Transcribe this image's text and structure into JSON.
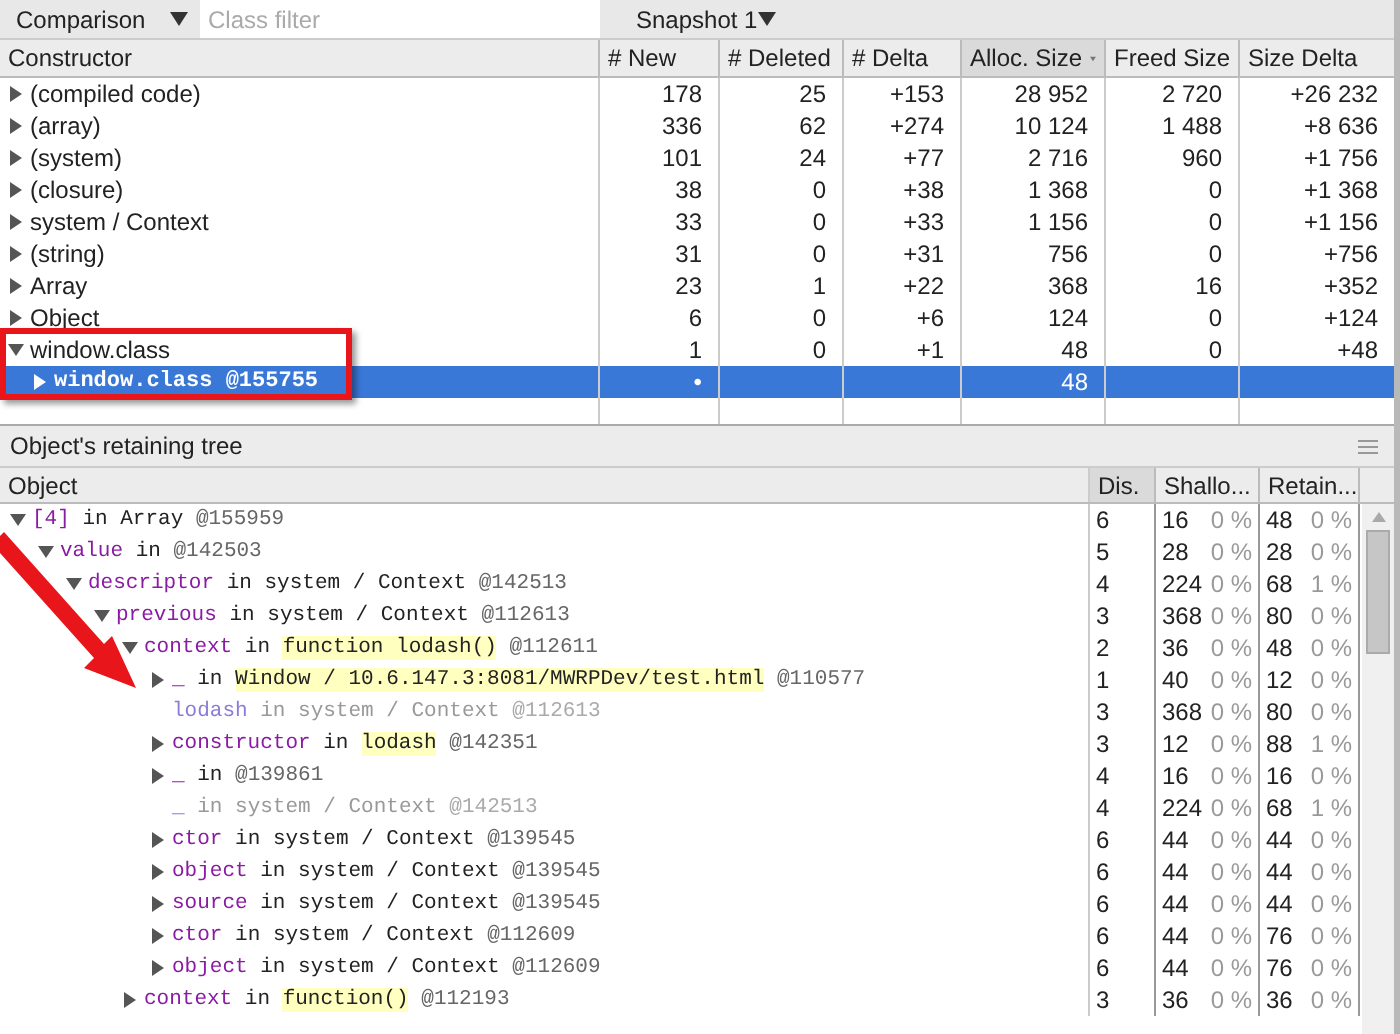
{
  "toolbar": {
    "view_select": "Comparison",
    "class_filter": {
      "placeholder": "Class filter"
    },
    "snapshot_select": "Snapshot 1"
  },
  "summary_table": {
    "columns": [
      {
        "label": "Constructor",
        "sorted": false
      },
      {
        "label": "# New",
        "sorted": false
      },
      {
        "label": "# Deleted",
        "sorted": false
      },
      {
        "label": "# Delta",
        "sorted": false
      },
      {
        "label": "Alloc. Size",
        "sorted": true
      },
      {
        "label": "Freed Size",
        "sorted": false
      },
      {
        "label": "Size Delta",
        "sorted": false
      }
    ],
    "rows": [
      {
        "name": "(compiled code)",
        "new": "178",
        "deleted": "25",
        "delta": "+153",
        "alloc": "28 952",
        "freed": "2 720",
        "size_delta": "+26 232",
        "expanded": false,
        "selected": false
      },
      {
        "name": "(array)",
        "new": "336",
        "deleted": "62",
        "delta": "+274",
        "alloc": "10 124",
        "freed": "1 488",
        "size_delta": "+8 636",
        "expanded": false,
        "selected": false
      },
      {
        "name": "(system)",
        "new": "101",
        "deleted": "24",
        "delta": "+77",
        "alloc": "2 716",
        "freed": "960",
        "size_delta": "+1 756",
        "expanded": false,
        "selected": false
      },
      {
        "name": "(closure)",
        "new": "38",
        "deleted": "0",
        "delta": "+38",
        "alloc": "1 368",
        "freed": "0",
        "size_delta": "+1 368",
        "expanded": false,
        "selected": false
      },
      {
        "name": "system / Context",
        "new": "33",
        "deleted": "0",
        "delta": "+33",
        "alloc": "1 156",
        "freed": "0",
        "size_delta": "+1 156",
        "expanded": false,
        "selected": false
      },
      {
        "name": "(string)",
        "new": "31",
        "deleted": "0",
        "delta": "+31",
        "alloc": "756",
        "freed": "0",
        "size_delta": "+756",
        "expanded": false,
        "selected": false
      },
      {
        "name": "Array",
        "new": "23",
        "deleted": "1",
        "delta": "+22",
        "alloc": "368",
        "freed": "16",
        "size_delta": "+352",
        "expanded": false,
        "selected": false
      },
      {
        "name": "Object",
        "new": "6",
        "deleted": "0",
        "delta": "+6",
        "alloc": "124",
        "freed": "0",
        "size_delta": "+124",
        "expanded": false,
        "selected": false
      },
      {
        "name": "window.class",
        "new": "1",
        "deleted": "0",
        "delta": "+1",
        "alloc": "48",
        "freed": "0",
        "size_delta": "+48",
        "expanded": true,
        "selected": false,
        "children": [
          {
            "name": "window.class @155755",
            "new": "•",
            "alloc": "48",
            "expanded": false,
            "selected": true
          }
        ]
      }
    ]
  },
  "retaining_tree": {
    "title": "Object's retaining tree",
    "columns": [
      {
        "label": "Object",
        "sorted": false
      },
      {
        "label": "Dis.",
        "sorted": true
      },
      {
        "label": "Shallo...",
        "sorted": false
      },
      {
        "label": "Retain...",
        "sorted": false
      }
    ],
    "rows": [
      {
        "kind": "node",
        "expanded": true,
        "name": "[4]",
        "relation": "in",
        "owner": "Array",
        "owner_highlighted": false,
        "id": "@155959",
        "dimmed": false,
        "distance": "6",
        "shallow": "16",
        "shallow_pct": "0 %",
        "retained": "48",
        "retained_pct": "0 %",
        "children": [
          {
            "kind": "node",
            "expanded": true,
            "name": "value",
            "relation": "in",
            "id": "@142503",
            "dimmed": false,
            "distance": "5",
            "shallow": "28",
            "shallow_pct": "0 %",
            "retained": "28",
            "retained_pct": "0 %",
            "children": [
              {
                "kind": "node",
                "expanded": true,
                "name": "descriptor",
                "relation": "in",
                "owner": "system / Context",
                "owner_highlighted": false,
                "id": "@142513",
                "dimmed": false,
                "distance": "4",
                "shallow": "224",
                "shallow_pct": "0 %",
                "retained": "68",
                "retained_pct": "1 %",
                "children": [
                  {
                    "kind": "node",
                    "expanded": true,
                    "name": "previous",
                    "relation": "in",
                    "owner": "system / Context",
                    "owner_highlighted": false,
                    "id": "@112613",
                    "dimmed": false,
                    "distance": "3",
                    "shallow": "368",
                    "shallow_pct": "0 %",
                    "retained": "80",
                    "retained_pct": "0 %",
                    "children": [
                      {
                        "kind": "node",
                        "expanded": true,
                        "name": "context",
                        "relation": "in",
                        "owner": "function lodash()",
                        "owner_highlighted": true,
                        "id": "@112611",
                        "dimmed": false,
                        "distance": "2",
                        "shallow": "36",
                        "shallow_pct": "0 %",
                        "retained": "48",
                        "retained_pct": "0 %",
                        "children": [
                          {
                            "kind": "node",
                            "expanded": false,
                            "name": "_",
                            "relation": "in",
                            "owner": "Window / 10.6.147.3:8081/MWRPDev/test.html",
                            "owner_highlighted": true,
                            "id": "@110577",
                            "dimmed": false,
                            "distance": "1",
                            "shallow": "40",
                            "shallow_pct": "0 %",
                            "retained": "12",
                            "retained_pct": "0 %"
                          },
                          {
                            "kind": "leaf",
                            "name": "lodash",
                            "relation": "in",
                            "owner": "system / Context",
                            "owner_highlighted": false,
                            "id": "@112613",
                            "dimmed": true,
                            "distance": "3",
                            "shallow": "368",
                            "shallow_pct": "0 %",
                            "retained": "80",
                            "retained_pct": "0 %"
                          },
                          {
                            "kind": "node",
                            "expanded": false,
                            "name": "constructor",
                            "relation": "in",
                            "owner": "lodash",
                            "owner_highlighted": true,
                            "id": "@142351",
                            "dimmed": false,
                            "distance": "3",
                            "shallow": "12",
                            "shallow_pct": "0 %",
                            "retained": "88",
                            "retained_pct": "1 %"
                          },
                          {
                            "kind": "node",
                            "expanded": false,
                            "name": "_",
                            "relation": "in",
                            "id": "@139861",
                            "dimmed": false,
                            "distance": "4",
                            "shallow": "16",
                            "shallow_pct": "0 %",
                            "retained": "16",
                            "retained_pct": "0 %"
                          },
                          {
                            "kind": "leaf",
                            "name": "_",
                            "relation": "in",
                            "owner": "system / Context",
                            "owner_highlighted": false,
                            "id": "@142513",
                            "dimmed": true,
                            "distance": "4",
                            "shallow": "224",
                            "shallow_pct": "0 %",
                            "retained": "68",
                            "retained_pct": "1 %"
                          },
                          {
                            "kind": "node",
                            "expanded": false,
                            "name": "ctor",
                            "relation": "in",
                            "owner": "system / Context",
                            "owner_highlighted": false,
                            "id": "@139545",
                            "dimmed": false,
                            "distance": "6",
                            "shallow": "44",
                            "shallow_pct": "0 %",
                            "retained": "44",
                            "retained_pct": "0 %"
                          },
                          {
                            "kind": "node",
                            "expanded": false,
                            "name": "object",
                            "relation": "in",
                            "owner": "system / Context",
                            "owner_highlighted": false,
                            "id": "@139545",
                            "dimmed": false,
                            "distance": "6",
                            "shallow": "44",
                            "shallow_pct": "0 %",
                            "retained": "44",
                            "retained_pct": "0 %"
                          },
                          {
                            "kind": "node",
                            "expanded": false,
                            "name": "source",
                            "relation": "in",
                            "owner": "system / Context",
                            "owner_highlighted": false,
                            "id": "@139545",
                            "dimmed": false,
                            "distance": "6",
                            "shallow": "44",
                            "shallow_pct": "0 %",
                            "retained": "44",
                            "retained_pct": "0 %"
                          },
                          {
                            "kind": "node",
                            "expanded": false,
                            "name": "ctor",
                            "relation": "in",
                            "owner": "system / Context",
                            "owner_highlighted": false,
                            "id": "@112609",
                            "dimmed": false,
                            "distance": "6",
                            "shallow": "44",
                            "shallow_pct": "0 %",
                            "retained": "76",
                            "retained_pct": "0 %"
                          },
                          {
                            "kind": "node",
                            "expanded": false,
                            "name": "object",
                            "relation": "in",
                            "owner": "system / Context",
                            "owner_highlighted": false,
                            "id": "@112609",
                            "dimmed": false,
                            "distance": "6",
                            "shallow": "44",
                            "shallow_pct": "0 %",
                            "retained": "76",
                            "retained_pct": "0 %"
                          }
                        ]
                      },
                      {
                        "kind": "node",
                        "expanded": false,
                        "name": "context",
                        "relation": "in",
                        "owner": "function()",
                        "owner_highlighted": true,
                        "id": "@112193",
                        "dimmed": false,
                        "distance": "3",
                        "shallow": "36",
                        "shallow_pct": "0 %",
                        "retained": "36",
                        "retained_pct": "0 %"
                      }
                    ]
                  }
                ]
              }
            ]
          }
        ]
      }
    ]
  }
}
